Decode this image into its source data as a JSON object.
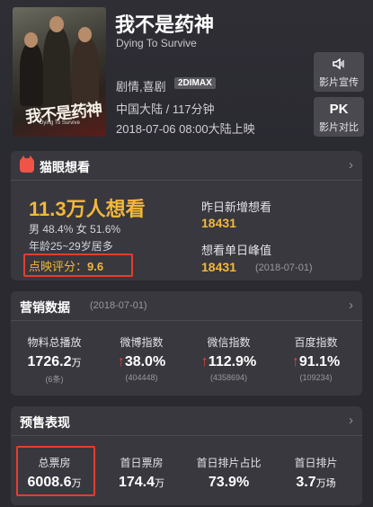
{
  "movie": {
    "title": "我不是药神",
    "english_title": "Dying To Survive",
    "genre": "剧情,喜剧",
    "format_badge": "2DIMAX",
    "country_duration": "中国大陆 / 117分钟",
    "release": "2018-07-06 08:00大陆上映",
    "poster_title": "我不是药神",
    "poster_subtitle": "Dying To Survive"
  },
  "actions": [
    {
      "icon": "speaker-icon",
      "glyph": "◁⦚",
      "label": "影片宣传"
    },
    {
      "icon": "pk-icon",
      "glyph": "PK",
      "label": "影片对比"
    }
  ],
  "maoyan": {
    "title": "猫眼想看",
    "want_count": "11.3万人想看",
    "gender": "男 48.4% 女 51.6%",
    "age": "年龄25~29岁居多",
    "score_label": "点映评分：",
    "score_value": "9.6",
    "yesterday_label": "昨日新增想看",
    "yesterday_value": "18431",
    "peak_label": "想看单日峰值",
    "peak_value": "18431",
    "peak_date": "(2018-07-01)"
  },
  "marketing": {
    "title": "营销数据",
    "date": "(2018-07-01)",
    "stats": [
      {
        "label": "物料总播放",
        "value": "1726.2",
        "unit": "万",
        "arrow": "",
        "sub": "(6条)"
      },
      {
        "label": "微博指数",
        "value": "38.0%",
        "unit": "",
        "arrow": "↑",
        "sub": "(404448)"
      },
      {
        "label": "微信指数",
        "value": "112.9%",
        "unit": "",
        "arrow": "↑",
        "sub": "(4358694)"
      },
      {
        "label": "百度指数",
        "value": "91.1%",
        "unit": "",
        "arrow": "↑",
        "sub": "(109234)"
      }
    ]
  },
  "presale": {
    "title": "预售表现",
    "stats": [
      {
        "label": "总票房",
        "value": "6008.6",
        "unit": "万"
      },
      {
        "label": "首日票房",
        "value": "174.4",
        "unit": "万"
      },
      {
        "label": "首日排片占比",
        "value": "73.9%",
        "unit": ""
      },
      {
        "label": "首日排片",
        "value": "3.7",
        "unit": "万场"
      }
    ]
  },
  "colors": {
    "accent": "#f3b83a",
    "highlight": "#e63c2f",
    "arrow": "#e8463a"
  }
}
